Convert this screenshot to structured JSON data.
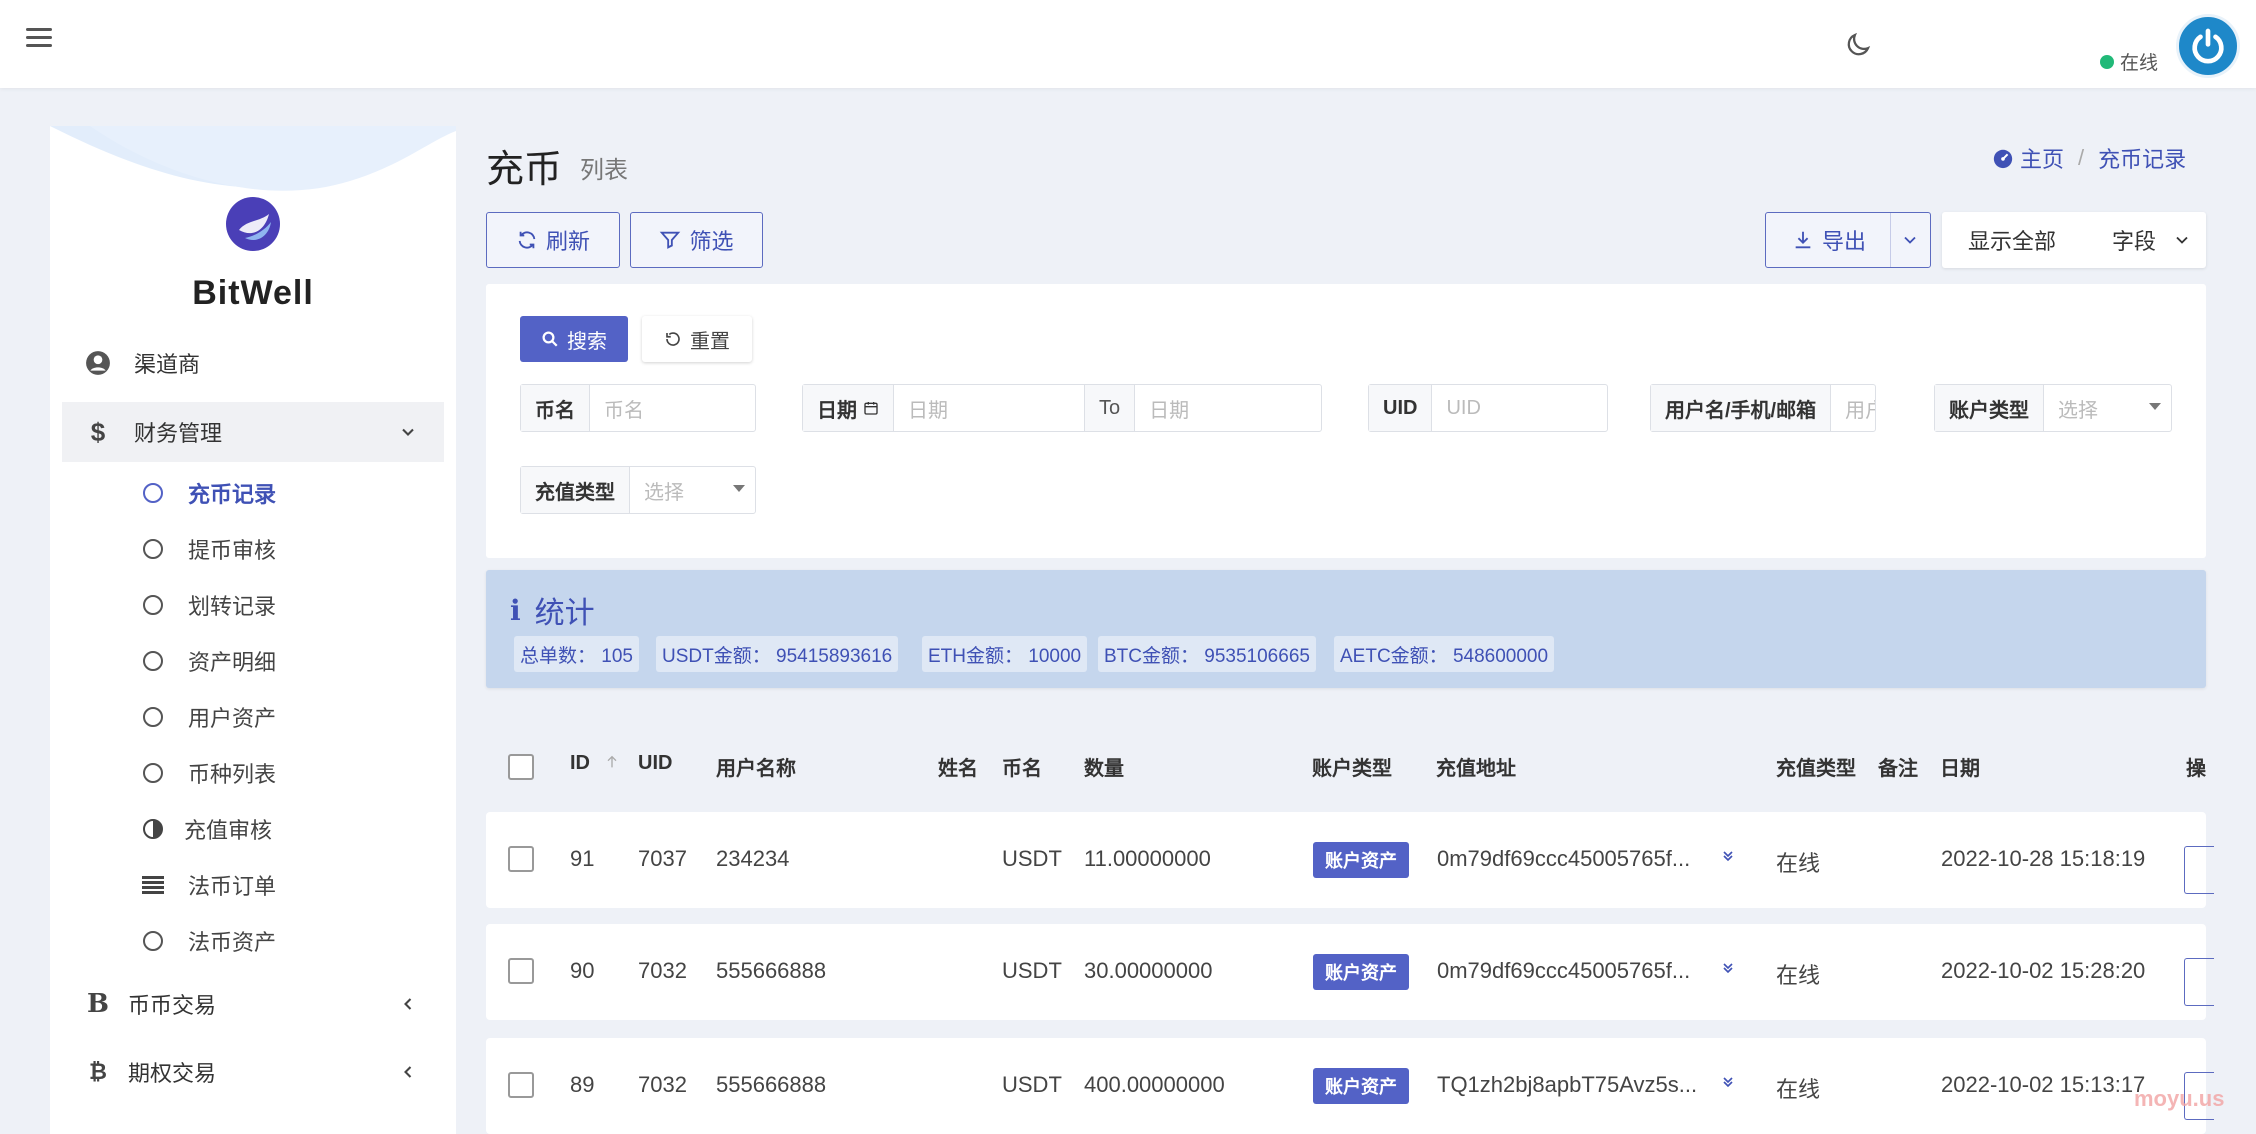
{
  "navbar": {
    "status_text": "在线"
  },
  "sidebar": {
    "brand": "BitWell",
    "items": [
      {
        "label": "渠道商"
      },
      {
        "label": "财务管理"
      },
      {
        "label": "币币交易"
      },
      {
        "label": "期权交易"
      }
    ],
    "sub_items": [
      {
        "label": "充币记录"
      },
      {
        "label": "提币审核"
      },
      {
        "label": "划转记录"
      },
      {
        "label": "资产明细"
      },
      {
        "label": "用户资产"
      },
      {
        "label": "币种列表"
      },
      {
        "label": "充值审核"
      },
      {
        "label": "法币订单"
      },
      {
        "label": "法币资产"
      }
    ]
  },
  "header": {
    "title": "充币",
    "subtitle": "列表",
    "breadcrumb": [
      "主页",
      "充币记录"
    ]
  },
  "toolbar": {
    "refresh": "刷新",
    "filter": "筛选",
    "export": "导出",
    "show_all": "显示全部",
    "fields": "字段"
  },
  "filters": {
    "search": "搜索",
    "reset": "重置",
    "coin_label": "币名",
    "coin_placeholder": "币名",
    "date_label": "日期",
    "date_placeholder": "日期",
    "to": "To",
    "date_end_placeholder": "日期",
    "uid_label": "UID",
    "uid_placeholder": "UID",
    "user_label": "用户名/手机/邮箱",
    "user_placeholder": "用户",
    "account_type_label": "账户类型",
    "account_type_placeholder": "选择",
    "recharge_type_label": "充值类型",
    "recharge_type_placeholder": "选择"
  },
  "stats": {
    "title": "统计",
    "badges": [
      "总单数：  105",
      "USDT金额：  95415893616",
      "ETH金额：  10000",
      "BTC金额：  9535106665",
      "AETC金额：  548600000"
    ]
  },
  "table": {
    "columns": [
      "ID",
      "UID",
      "用户名称",
      "姓名",
      "币名",
      "数量",
      "账户类型",
      "充值地址",
      "充值类型",
      "备注",
      "日期",
      "操"
    ],
    "rows": [
      {
        "id": "91",
        "uid": "7037",
        "username": "234234",
        "coin": "USDT",
        "amount": "11.00000000",
        "account_type": "账户资产",
        "address": "0m79df69ccc45005765f...",
        "recharge_type": "在线",
        "date": "2022-10-28 15:18:19"
      },
      {
        "id": "90",
        "uid": "7032",
        "username": "555666888",
        "coin": "USDT",
        "amount": "30.00000000",
        "account_type": "账户资产",
        "address": "0m79df69ccc45005765f...",
        "recharge_type": "在线",
        "date": "2022-10-02 15:28:20"
      },
      {
        "id": "89",
        "uid": "7032",
        "username": "555666888",
        "coin": "USDT",
        "amount": "400.00000000",
        "account_type": "账户资产",
        "address": "TQ1zh2bj8apbT75Avz5s...",
        "recharge_type": "在线",
        "date": "2022-10-02 15:13:17"
      }
    ]
  },
  "watermark": "moyu.us",
  "colors": {
    "accent": "#3f51b5",
    "badge_bg": "#5362c6",
    "stats_bg": "#c5d6ed",
    "online": "#21b978"
  }
}
